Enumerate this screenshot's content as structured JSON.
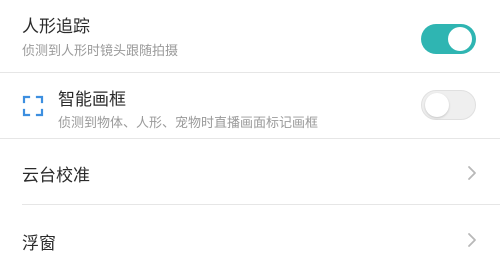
{
  "colors": {
    "toggle_on": "#2fb5b2",
    "toggle_off": "#efefef",
    "frame_icon": "#3d8fe0",
    "divider": "#e6e6e6"
  },
  "settings": {
    "human_tracking": {
      "title": "人形追踪",
      "subtitle": "侦测到人形时镜头跟随拍摄",
      "enabled": true
    },
    "smart_frame": {
      "icon": "frame-corners-icon",
      "title": "智能画框",
      "subtitle": "侦测到物体、人形、宠物时直播画面标记画框",
      "enabled": false
    },
    "gimbal_calibration": {
      "title": "云台校准",
      "icon": "chevron-right-icon"
    },
    "floating_window": {
      "title": "浮窗",
      "icon": "chevron-right-icon"
    }
  }
}
